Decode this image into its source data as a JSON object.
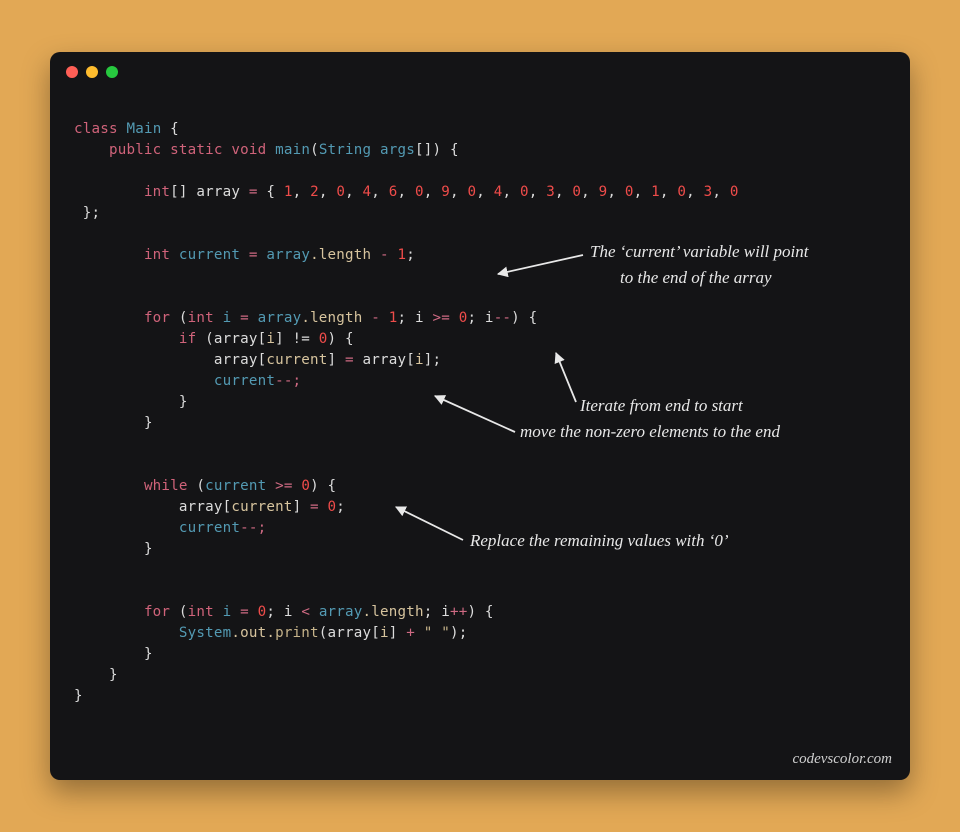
{
  "credit": "codevscolor.com",
  "annotations": {
    "a1_l1": "The ‘current’ variable will point",
    "a1_l2": "to the end of the array",
    "a2_l1": "Iterate from end to start",
    "a2_l2": "move the non-zero elements to the end",
    "a3": "Replace the remaining values with ‘0’"
  },
  "code": {
    "l01_class": "class",
    "l01_main": "Main",
    "l01_br": " {",
    "l02_pub": "public",
    "l02_stat": "static",
    "l02_void": "void",
    "l02_mname": "main",
    "l02_op": "(",
    "l02_str": "String",
    "l02_args": "args",
    "l02_rest": "[]) {",
    "l04_int": "int",
    "l04_arr": "[] array ",
    "l04_eq": "=",
    "l04_open": " { ",
    "l04_nums": [
      "1",
      "2",
      "0",
      "4",
      "6",
      "0",
      "9",
      "0",
      "4",
      "0",
      "3",
      "0",
      "9",
      "0",
      "1",
      "0",
      "3",
      "0"
    ],
    "l04_close": " };",
    "l06_int": "int",
    "l06_cur": " current ",
    "l06_eq": "=",
    "l06_rhs": " array",
    "l06_len": ".length",
    "l06_minus": " - ",
    "l06_one": "1",
    "l06_semi": ";",
    "l08_for": "for",
    "l08_open": " (",
    "l08_int": "int",
    "l08_i": " i ",
    "l08_eq": "=",
    "l08_arr": " array",
    "l08_len": ".length",
    "l08_minus": " - ",
    "l08_one": "1",
    "l08_s1": "; i ",
    "l08_ge": ">=",
    "l08_zero": " 0",
    "l08_s2": "; i",
    "l08_dec": "--",
    "l08_close": ") {",
    "l09_if": "if",
    "l09_open": " (array[",
    "l09_i": "i",
    "l09_ne": "] != ",
    "l09_zero": "0",
    "l09_close": ") {",
    "l10_p1": "array[",
    "l10_cur": "current",
    "l10_mid": "] ",
    "l10_eq": "=",
    "l10_p2": " array[",
    "l10_i": "i",
    "l10_end": "];",
    "l11_cur": "current",
    "l11_dec": "--;",
    "l12_close": "}",
    "l13_close": "}",
    "l15_while": "while",
    "l15_open": " (",
    "l15_cur": "current",
    "l15_ge": " >= ",
    "l15_zero": "0",
    "l15_close": ") {",
    "l16_p1": "array[",
    "l16_cur": "current",
    "l16_mid": "] ",
    "l16_eq": "=",
    "l16_zero": " 0",
    "l16_end": ";",
    "l17_cur": "current",
    "l17_dec": "--;",
    "l18_close": "}",
    "l20_for": "for",
    "l20_open": " (",
    "l20_int": "int",
    "l20_i": " i ",
    "l20_eq": "=",
    "l20_zero": " 0",
    "l20_s1": "; i ",
    "l20_lt": "<",
    "l20_arr": " array",
    "l20_len": ".length",
    "l20_s2": "; i",
    "l20_inc": "++",
    "l20_close": ") {",
    "l21_sys": "System",
    "l21_out": ".out.",
    "l21_pr": "print",
    "l21_open": "(array[",
    "l21_i": "i",
    "l21_mid": "] ",
    "l21_plus": "+",
    "l21_sp": " ",
    "l21_str": "\" \"",
    "l21_close": ");",
    "l22_close": "}",
    "l23_close": "}",
    "l24_close": "}"
  }
}
